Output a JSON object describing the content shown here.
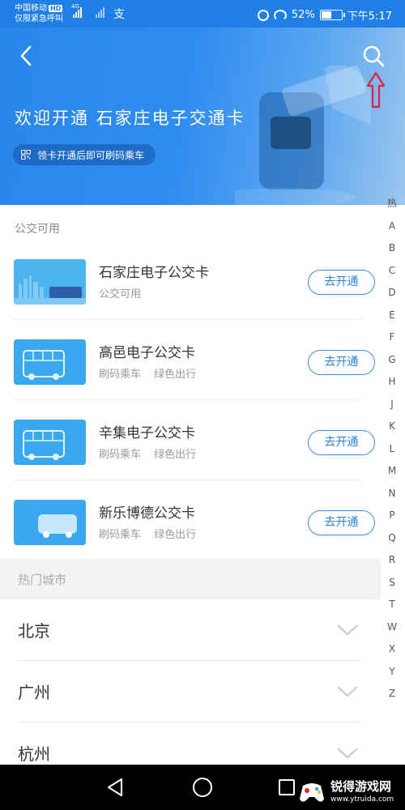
{
  "status_bar": {
    "carrier": "中国移动",
    "hd": "HD",
    "emergency": "仅限紧急呼叫",
    "network": "4G",
    "app_glyph": "支",
    "battery": "52%",
    "battery_level": 0.52,
    "time": "下午5:17"
  },
  "header": {
    "title": "欢迎开通 石家庄电子交通卡",
    "subtitle": "领卡开通后即可刷码乘车",
    "back_icon": "back-chevron-icon",
    "search_icon": "search-icon",
    "annotation_icon": "red-up-arrow",
    "accent": "#2f8cf0"
  },
  "section": {
    "label": "公交可用"
  },
  "cards": [
    {
      "name": "石家庄电子公交卡",
      "desc": "公交可用",
      "button": "去开通"
    },
    {
      "name": "高邑电子公交卡",
      "desc": "刷码乘车 绿色出行",
      "button": "去开通"
    },
    {
      "name": "辛集电子公交卡",
      "desc": "刷码乘车 绿色出行",
      "button": "去开通"
    },
    {
      "name": "新乐博德公交卡",
      "desc": "刷码乘车 绿色出行",
      "button": "去开通"
    }
  ],
  "hot_cities": {
    "label": "热门城市",
    "cities": [
      "北京",
      "广州",
      "杭州"
    ]
  },
  "alphabet": [
    "热",
    "A",
    "B",
    "C",
    "D",
    "E",
    "F",
    "G",
    "H",
    "J",
    "K",
    "L",
    "M",
    "N",
    "P",
    "Q",
    "R",
    "S",
    "T",
    "W",
    "X",
    "Y",
    "Z"
  ],
  "watermark": {
    "name": "锐得游戏网",
    "url": "www.ytruida.com"
  }
}
